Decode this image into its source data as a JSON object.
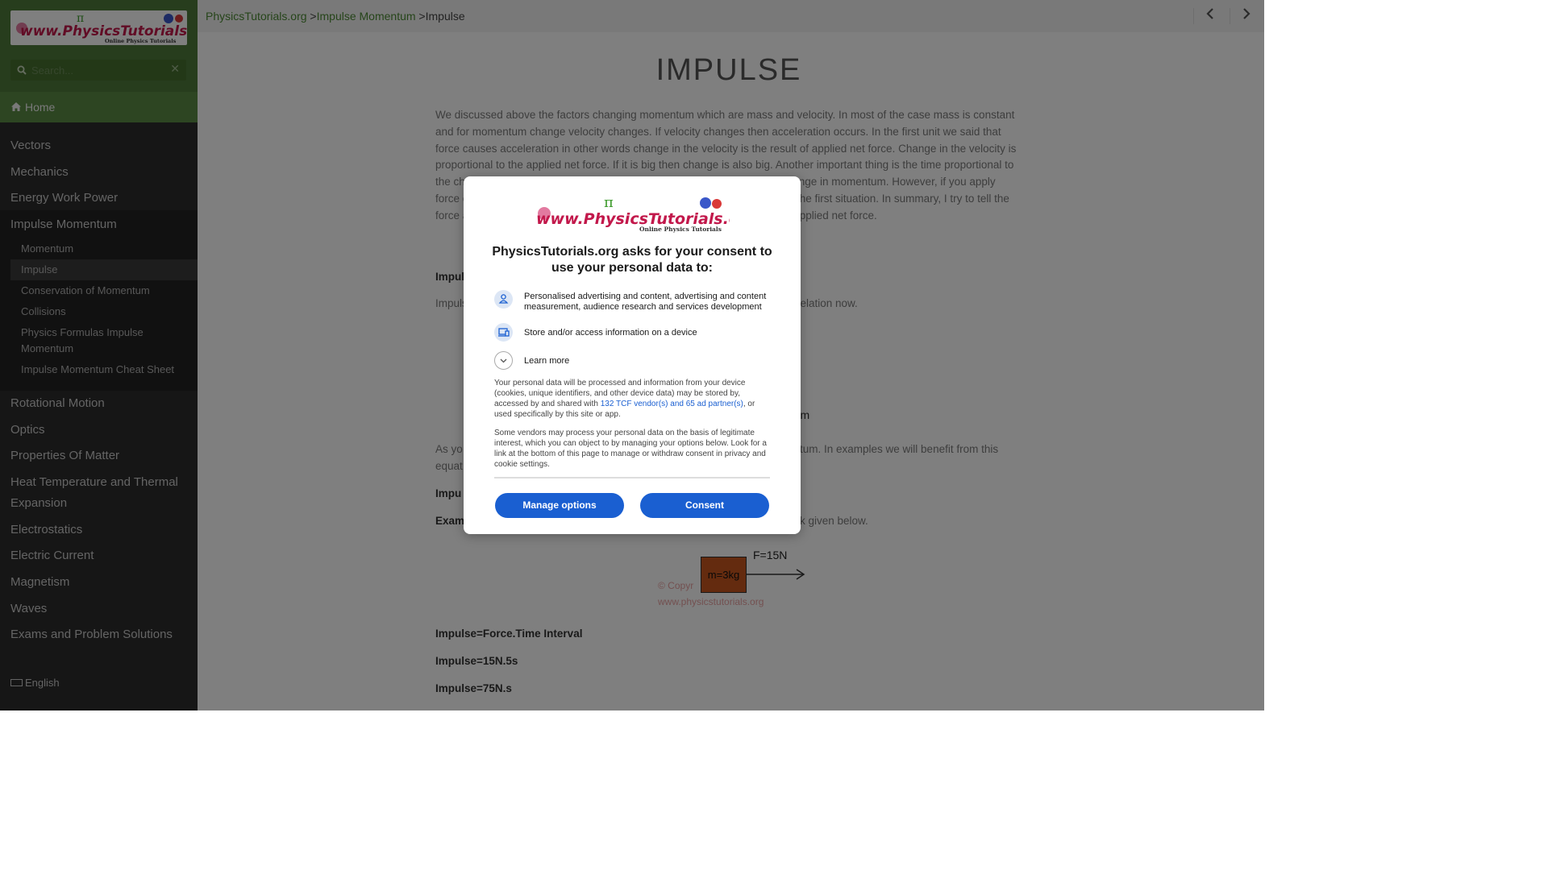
{
  "sidebar": {
    "search_placeholder": "Search...",
    "home_label": "Home",
    "nav": [
      "Vectors",
      "Mechanics",
      "Energy Work Power",
      "Impulse Momentum",
      "Rotational Motion",
      "Optics",
      "Properties Of Matter",
      "Heat Temperature and Thermal",
      "Expansion",
      "Electrostatics",
      "Electric Current",
      "Magnetism",
      "Waves",
      "Exams and Problem Solutions"
    ],
    "subnav": [
      "Momentum",
      "Impulse",
      "Conservation of Momentum",
      "Collisions",
      "Physics Formulas Impulse",
      "Momentum",
      "Impulse Momentum Cheat Sheet"
    ],
    "language": "English"
  },
  "breadcrumb": {
    "site": "PhysicsTutorials.org",
    "sep1": " >",
    "section": "Impulse Momentum",
    "sep2": " >",
    "current": "Impulse"
  },
  "page": {
    "title": "IMPULSE",
    "paragraph1": "We discussed above the factors changing momentum which are mass and velocity. In most of the case mass is constant and for momentum change velocity changes. If velocity changes then acceleration occurs. In the first unit we said that force causes acceleration in other words change in the velocity is the result of applied net force. Change in the velocity is proportional to the applied net force. If it is big then change is also big. Another important thing is the time proportional to the change in velocity. If you apply the force for a short time interval the change in momentum. However, if you apply force on an object long period of time, change in momentum is bigger than the first situation. In summary, I try to tell the force and the time interval it applied. Impulse is also a vector quantity with applied net force.",
    "impulse_heading": "Impulse",
    "impulse_line": "Impulse",
    "impulse_line_end": "relation now.",
    "momentum_frag": "rum",
    "as_you": "As yo",
    "as_you_end": "tum. In examples we will benefit from this",
    "equat": "equat",
    "impu": "Impu",
    "exam": "Exam",
    "exam_end": "k given below.",
    "eq1": "Impulse=Force.Time Interval",
    "eq2": "Impulse=15N.5s",
    "eq3": "Impulse=75N.s",
    "fig_force": "F=15N",
    "fig_mass": "m=3kg",
    "fig_copy1": "© Copyr",
    "fig_copy2": "www.physicstutorials.org"
  },
  "consent": {
    "title": "PhysicsTutorials.org asks for your consent to use your personal data to:",
    "purpose1": "Personalised advertising and content, advertising and content measurement, audience research and services development",
    "purpose2": "Store and/or access information on a device",
    "learn_more": "Learn more",
    "body1_a": "Your personal data will be processed and information from your device (cookies, unique identifiers, and other device data) may be stored by, accessed by and shared with ",
    "body1_link": "132 TCF vendor(s) and 65 ad partner(s)",
    "body1_b": ", or used specifically by this site or app.",
    "body2": "Some vendors may process your personal data on the basis of legitimate interest, which you can object to by managing your options below. Look for a link at the bottom of this page to manage or withdraw consent in privacy and cookie settings.",
    "manage_label": "Manage options",
    "consent_label": "Consent"
  },
  "colors": {
    "accent_green": "#4f7a3b",
    "consent_blue": "#1a5fd1"
  }
}
